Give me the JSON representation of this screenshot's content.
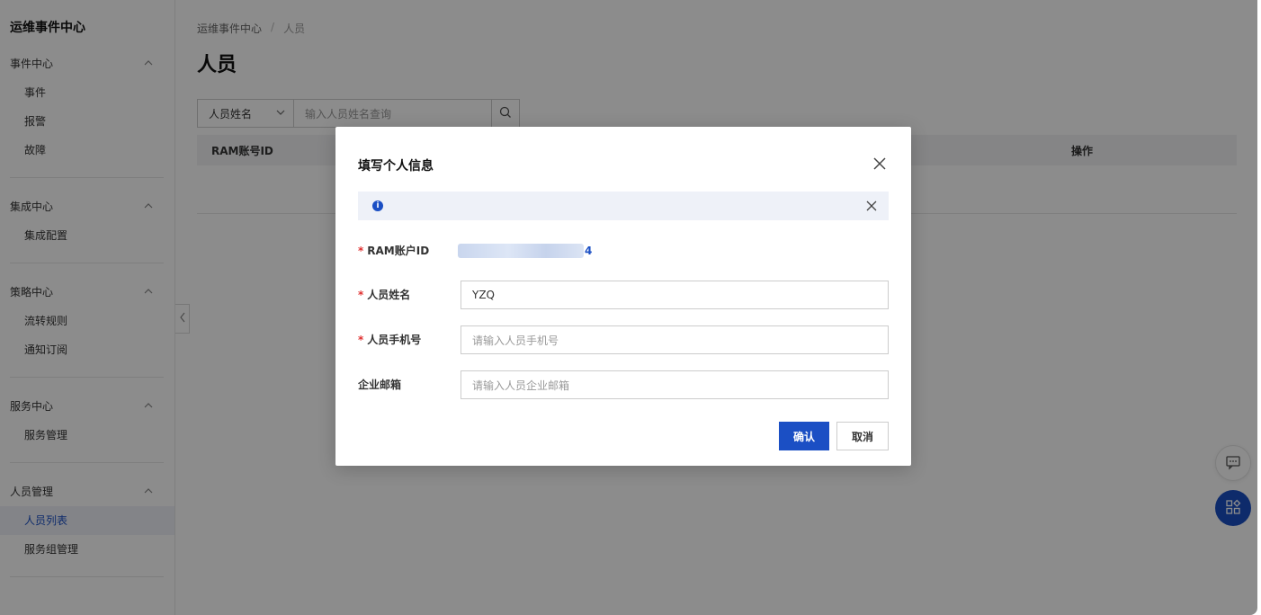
{
  "sidebar": {
    "title": "运维事件中心",
    "groups": [
      {
        "label": "事件中心",
        "items": [
          "事件",
          "报警",
          "故障"
        ]
      },
      {
        "label": "集成中心",
        "items": [
          "集成配置"
        ]
      },
      {
        "label": "策略中心",
        "items": [
          "流转规则",
          "通知订阅"
        ]
      },
      {
        "label": "服务中心",
        "items": [
          "服务管理"
        ]
      },
      {
        "label": "人员管理",
        "items": [
          "人员列表",
          "服务组管理"
        ]
      }
    ],
    "active_item": "人员列表"
  },
  "breadcrumb": {
    "root": "运维事件中心",
    "separator": "/",
    "current": "人员"
  },
  "page": {
    "title": "人员"
  },
  "search": {
    "select_value": "人员姓名",
    "placeholder": "输入人员姓名查询"
  },
  "table": {
    "headers": [
      "RAM账号ID",
      "操作"
    ]
  },
  "modal": {
    "title": "填写个人信息",
    "fields": {
      "ram": {
        "label": "RAM账户ID",
        "value_tail": "4"
      },
      "name": {
        "label": "人员姓名",
        "value": "YZQ"
      },
      "phone": {
        "label": "人员手机号",
        "placeholder": "请输入人员手机号"
      },
      "email": {
        "label": "企业邮箱",
        "placeholder": "请输入人员企业邮箱"
      }
    },
    "required_mark": "*",
    "confirm_label": "确认",
    "cancel_label": "取消"
  },
  "icons": {
    "info": "info-icon",
    "close": "close-icon",
    "search": "search-icon",
    "chevron": "chevron-up-icon",
    "feedback": "message-icon",
    "apps": "apps-icon"
  },
  "colors": {
    "primary": "#1b4fc4",
    "required": "#e03030"
  }
}
